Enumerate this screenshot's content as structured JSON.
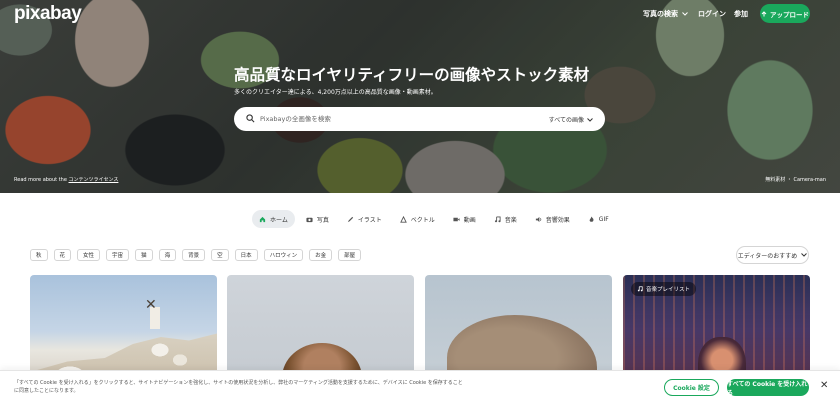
{
  "header": {
    "logo": "pixabay",
    "explore_label": "写真の検索",
    "login_label": "ログイン",
    "join_label": "参加",
    "upload_label": "アップロード"
  },
  "hero": {
    "title": "高品質なロイヤリティフリーの画像やストック素材",
    "subtitle": "多くのクリエイター達による、4,200万点以上の高品質な画像・動画素材。",
    "search_placeholder": "Pixabayの全画像を検索",
    "search_filter": "すべての画像",
    "credit_left_prefix": "Read more about the",
    "credit_left_link": "コンテンツライセンス",
    "credit_right": "無料素材 ・ Camera-man"
  },
  "tabs": [
    {
      "label": "ホーム",
      "icon": "home-icon",
      "active": true
    },
    {
      "label": "写真",
      "icon": "camera-icon"
    },
    {
      "label": "イラスト",
      "icon": "brush-icon"
    },
    {
      "label": "ベクトル",
      "icon": "vector-icon"
    },
    {
      "label": "動画",
      "icon": "video-icon"
    },
    {
      "label": "音楽",
      "icon": "music-icon"
    },
    {
      "label": "音響効果",
      "icon": "sound-effects-icon"
    },
    {
      "label": "GIF",
      "icon": "gif-icon"
    }
  ],
  "chips": [
    "秋",
    "花",
    "女性",
    "宇宙",
    "猫",
    "海",
    "背景",
    "空",
    "日本",
    "ハロウィン",
    "お金",
    "部屋"
  ],
  "sort_label": "エディターのおすすめ",
  "cards": {
    "badge_label": "音楽プレイリスト"
  },
  "cookie": {
    "text": "「すべての Cookie を受け入れる」をクリックすると、サイトナビゲーションを強化し、サイトの使用状況を分析し、弊社のマーケティング活動を支援するために、デバイスに Cookie を保存することに同意したことになります。",
    "settings_label": "Cookie 設定",
    "accept_label": "すべての Cookie を受け入れる"
  },
  "colors": {
    "brand_green": "#1aa85c"
  }
}
